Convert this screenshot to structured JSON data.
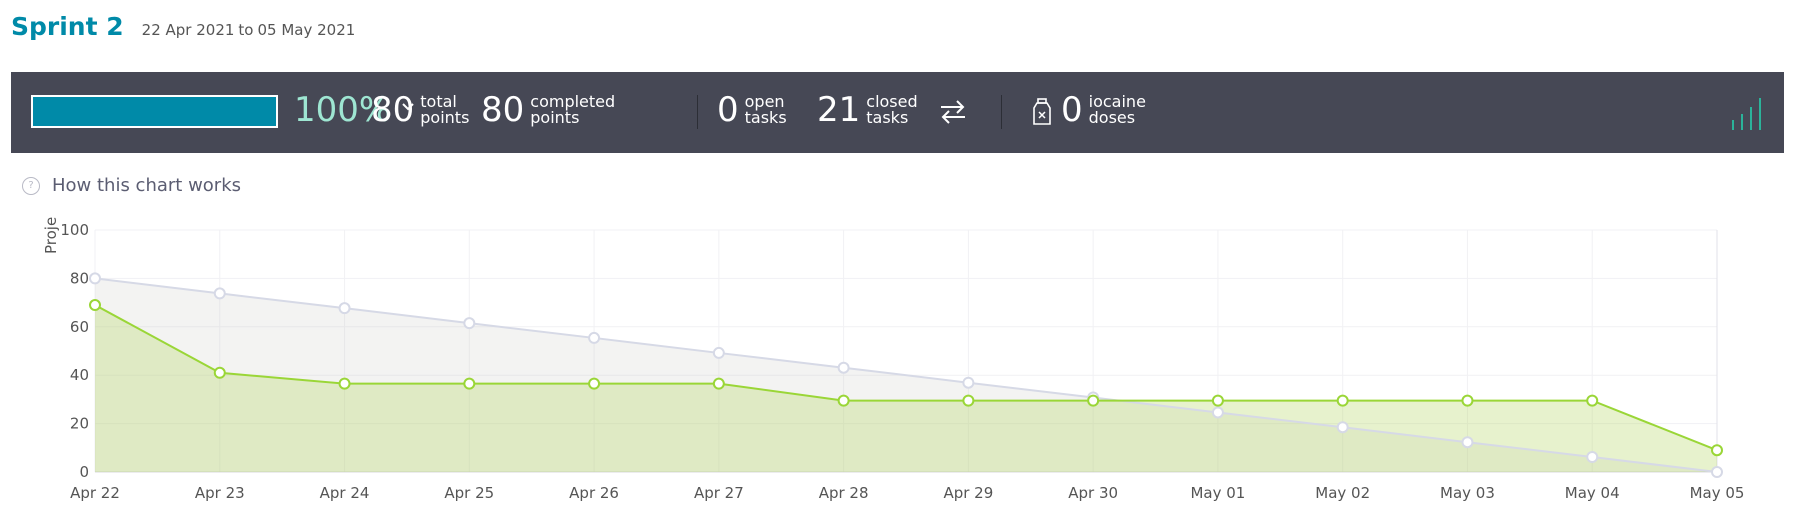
{
  "sprint": {
    "name": "Sprint 2",
    "start": "22 Apr 2021",
    "to": "to",
    "end": "05 May 2021"
  },
  "stats": {
    "progress_percent": 100,
    "progress_label": "100%",
    "total_points": {
      "value": "80",
      "l1": "total",
      "l2": "points"
    },
    "completed_points": {
      "value": "80",
      "l1": "completed",
      "l2": "points"
    },
    "open_tasks": {
      "value": "0",
      "l1": "open",
      "l2": "tasks"
    },
    "closed_tasks": {
      "value": "21",
      "l1": "closed",
      "l2": "tasks"
    },
    "iocaine_doses": {
      "value": "0",
      "l1": "iocaine",
      "l2": "doses"
    }
  },
  "help_link": "How this chart works",
  "colors": {
    "accent": "#008aa8",
    "bar": "#464855",
    "percent": "#9ee6d2",
    "optimal_line": "#d6d9e6",
    "real_line": "#9ad637",
    "signal": "#2bb39a"
  },
  "icons": [
    "chevron-down-icon",
    "swap-arrows-icon",
    "iocaine-flask-icon",
    "signal-bars-icon",
    "help-circle-icon"
  ],
  "chart_data": {
    "type": "area",
    "ylabel": "Proje",
    "ylim": [
      0,
      100
    ],
    "yticks": [
      0,
      20,
      40,
      60,
      80,
      100
    ],
    "grid": true,
    "categories": [
      "Apr 22",
      "Apr 23",
      "Apr 24",
      "Apr 25",
      "Apr 26",
      "Apr 27",
      "Apr 28",
      "Apr 29",
      "Apr 30",
      "May 01",
      "May 02",
      "May 03",
      "May 04",
      "May 05"
    ],
    "series": [
      {
        "values": [
          80,
          73.8,
          67.7,
          61.5,
          55.4,
          49.2,
          43.1,
          36.9,
          30.8,
          24.6,
          18.5,
          12.3,
          6.2,
          0
        ]
      },
      {
        "values": [
          69,
          41,
          36.5,
          36.5,
          36.5,
          36.5,
          29.5,
          29.5,
          29.5,
          29.5,
          29.5,
          29.5,
          29.5,
          9
        ]
      }
    ]
  }
}
